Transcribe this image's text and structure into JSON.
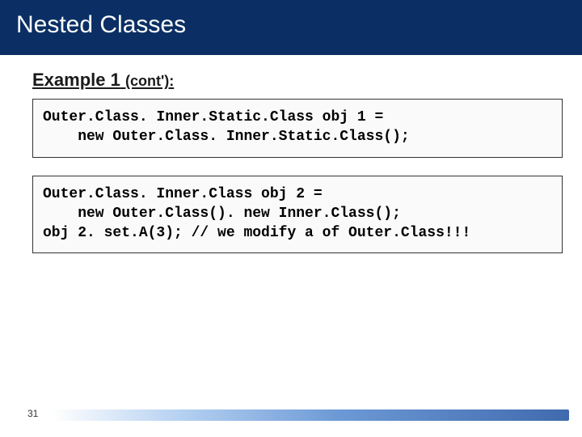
{
  "title": "Nested Classes",
  "subheading": "Example 1",
  "subheading_suffix": "(cont'):",
  "code_block_1": "Outer.Class. Inner.Static.Class obj 1 =\n    new Outer.Class. Inner.Static.Class();",
  "code_block_2": "Outer.Class. Inner.Class obj 2 =\n    new Outer.Class(). new Inner.Class();\nobj 2. set.A(3); // we modify a of Outer.Class!!!",
  "page_number": "31"
}
